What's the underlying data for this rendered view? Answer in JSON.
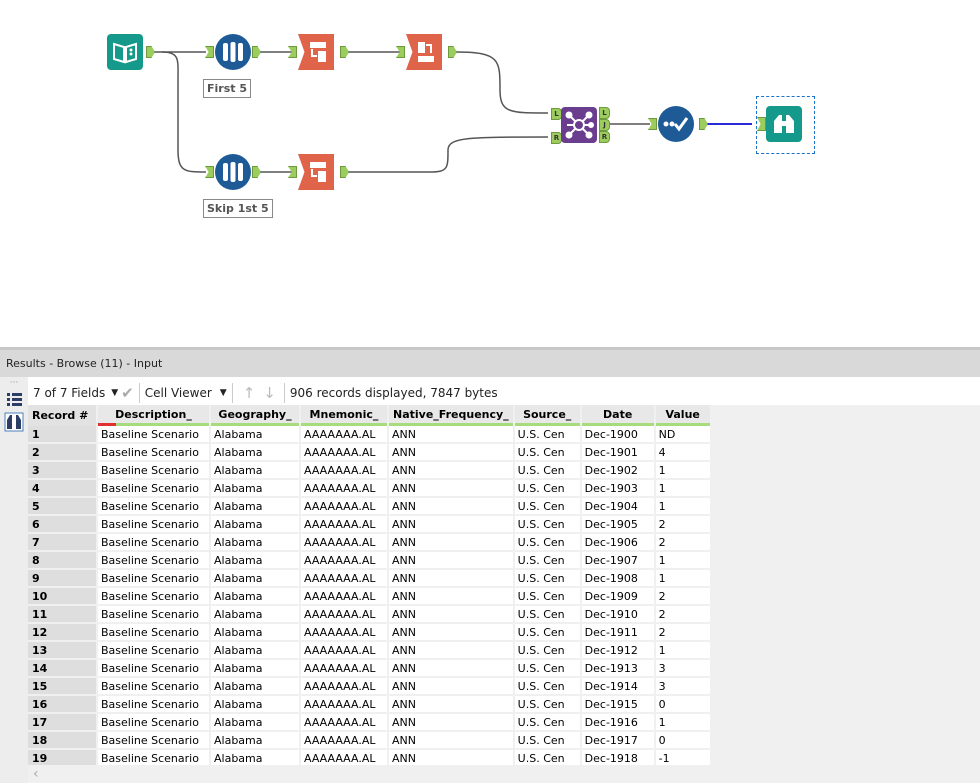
{
  "workflow": {
    "labels": {
      "first5": "First 5",
      "skip5": "Skip 1st 5"
    },
    "join_anchors": {
      "left": "L",
      "right": "R",
      "out_left": "L",
      "out_join": "J",
      "out_right": "R"
    }
  },
  "results": {
    "title": "Results - Browse (11) - Input",
    "fields_selector": "7 of 7 Fields",
    "cell_viewer": "Cell Viewer",
    "status": "906 records displayed, 7847 bytes",
    "columns": [
      "Record #",
      "Description_",
      "Geography_",
      "Mnemonic_",
      "Native_Frequency_",
      "Source_",
      "Date",
      "Value"
    ],
    "rows": [
      [
        "1",
        "Baseline Scenario",
        "Alabama",
        "AAAAAAA.AL",
        "ANN",
        "U.S. Cen",
        "Dec-1900",
        "ND"
      ],
      [
        "2",
        "Baseline Scenario",
        "Alabama",
        "AAAAAAA.AL",
        "ANN",
        "U.S. Cen",
        "Dec-1901",
        "4"
      ],
      [
        "3",
        "Baseline Scenario",
        "Alabama",
        "AAAAAAA.AL",
        "ANN",
        "U.S. Cen",
        "Dec-1902",
        "1"
      ],
      [
        "4",
        "Baseline Scenario",
        "Alabama",
        "AAAAAAA.AL",
        "ANN",
        "U.S. Cen",
        "Dec-1903",
        "1"
      ],
      [
        "5",
        "Baseline Scenario",
        "Alabama",
        "AAAAAAA.AL",
        "ANN",
        "U.S. Cen",
        "Dec-1904",
        "1"
      ],
      [
        "6",
        "Baseline Scenario",
        "Alabama",
        "AAAAAAA.AL",
        "ANN",
        "U.S. Cen",
        "Dec-1905",
        "2"
      ],
      [
        "7",
        "Baseline Scenario",
        "Alabama",
        "AAAAAAA.AL",
        "ANN",
        "U.S. Cen",
        "Dec-1906",
        "2"
      ],
      [
        "8",
        "Baseline Scenario",
        "Alabama",
        "AAAAAAA.AL",
        "ANN",
        "U.S. Cen",
        "Dec-1907",
        "1"
      ],
      [
        "9",
        "Baseline Scenario",
        "Alabama",
        "AAAAAAA.AL",
        "ANN",
        "U.S. Cen",
        "Dec-1908",
        "1"
      ],
      [
        "10",
        "Baseline Scenario",
        "Alabama",
        "AAAAAAA.AL",
        "ANN",
        "U.S. Cen",
        "Dec-1909",
        "2"
      ],
      [
        "11",
        "Baseline Scenario",
        "Alabama",
        "AAAAAAA.AL",
        "ANN",
        "U.S. Cen",
        "Dec-1910",
        "2"
      ],
      [
        "12",
        "Baseline Scenario",
        "Alabama",
        "AAAAAAA.AL",
        "ANN",
        "U.S. Cen",
        "Dec-1911",
        "2"
      ],
      [
        "13",
        "Baseline Scenario",
        "Alabama",
        "AAAAAAA.AL",
        "ANN",
        "U.S. Cen",
        "Dec-1912",
        "1"
      ],
      [
        "14",
        "Baseline Scenario",
        "Alabama",
        "AAAAAAA.AL",
        "ANN",
        "U.S. Cen",
        "Dec-1913",
        "3"
      ],
      [
        "15",
        "Baseline Scenario",
        "Alabama",
        "AAAAAAA.AL",
        "ANN",
        "U.S. Cen",
        "Dec-1914",
        "3"
      ],
      [
        "16",
        "Baseline Scenario",
        "Alabama",
        "AAAAAAA.AL",
        "ANN",
        "U.S. Cen",
        "Dec-1915",
        "0"
      ],
      [
        "17",
        "Baseline Scenario",
        "Alabama",
        "AAAAAAA.AL",
        "ANN",
        "U.S. Cen",
        "Dec-1916",
        "1"
      ],
      [
        "18",
        "Baseline Scenario",
        "Alabama",
        "AAAAAAA.AL",
        "ANN",
        "U.S. Cen",
        "Dec-1917",
        "0"
      ],
      [
        "19",
        "Baseline Scenario",
        "Alabama",
        "AAAAAAA.AL",
        "ANN",
        "U.S. Cen",
        "Dec-1918",
        "-1"
      ]
    ]
  },
  "colors": {
    "sample": "#1d5a96",
    "select": "#e0644a",
    "input": "#14998a",
    "join": "#6b3d8f",
    "anchor": "#9ccb5e"
  }
}
